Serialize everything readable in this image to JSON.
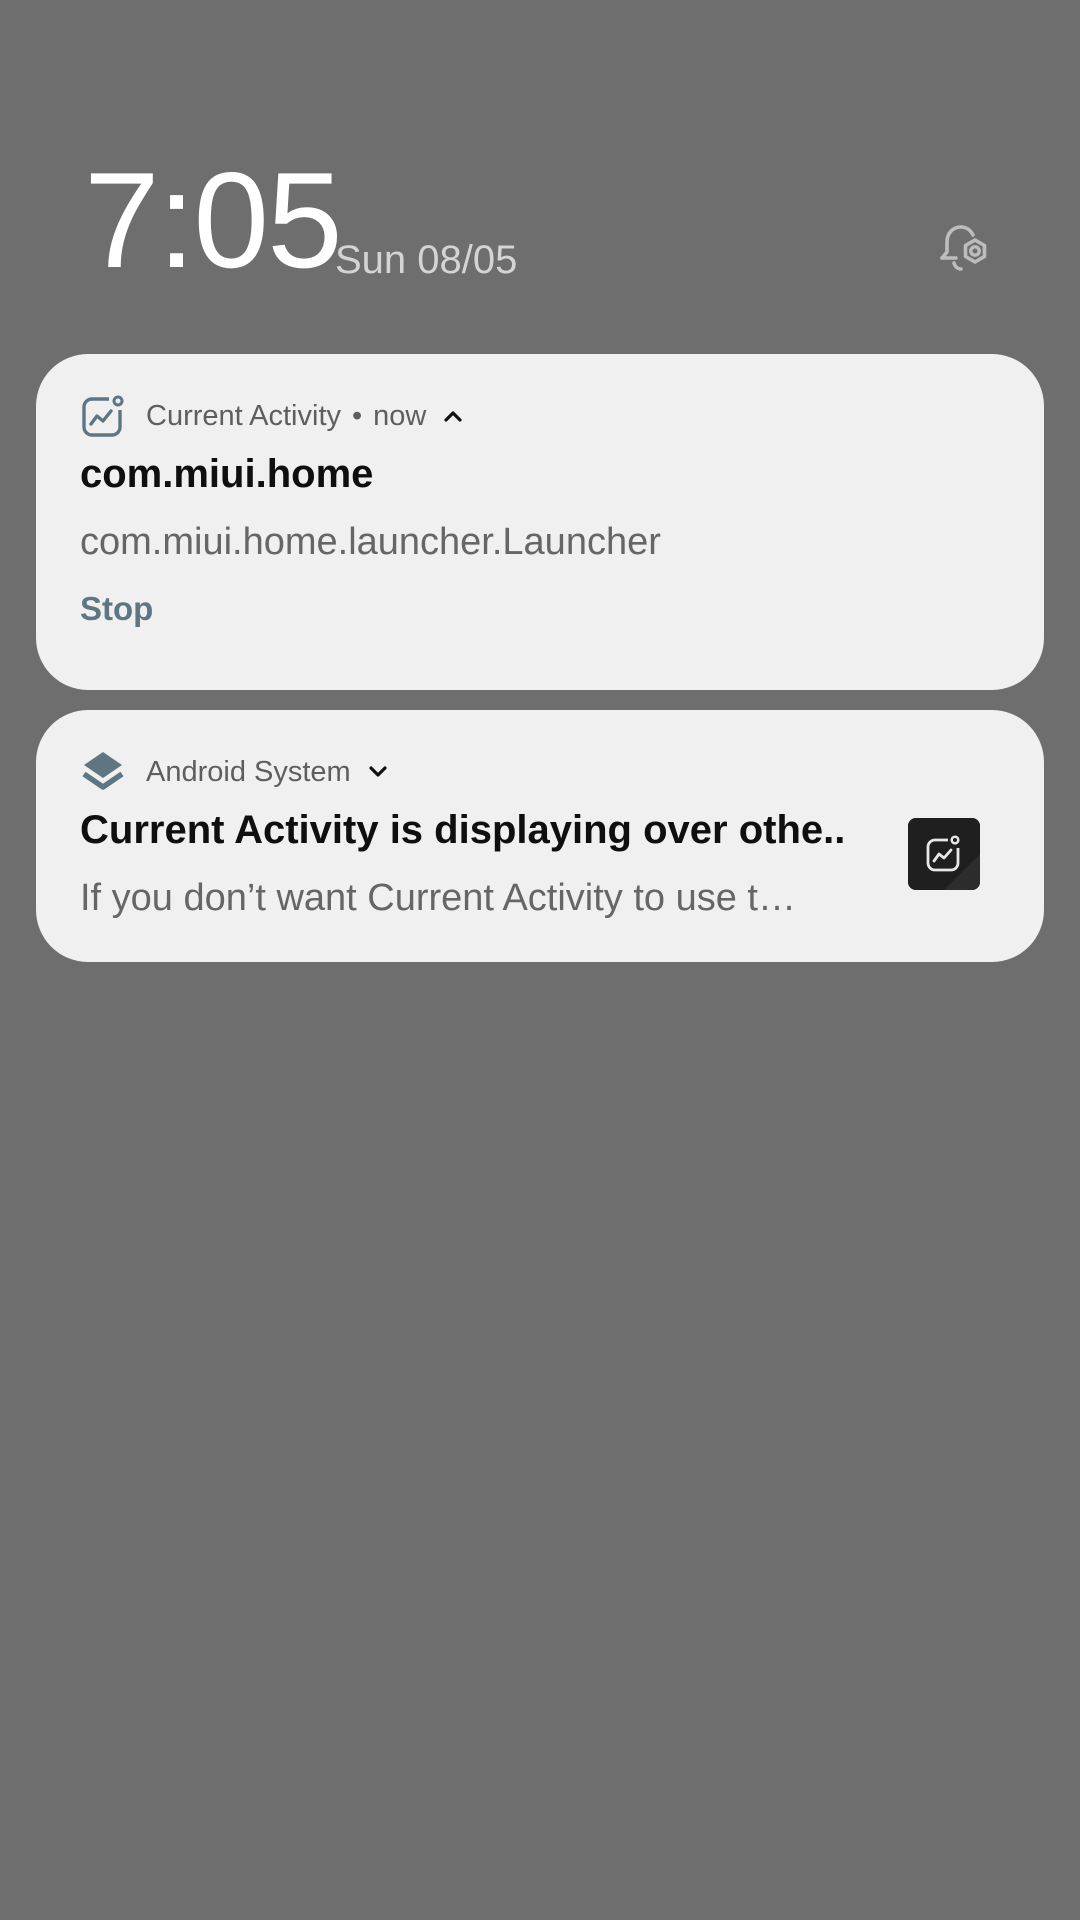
{
  "header": {
    "time": "7:05",
    "date": "Sun 08/05",
    "settings_icon": "notification-settings-icon"
  },
  "notifications": [
    {
      "app_name": "Current Activity",
      "separator": "•",
      "time": "now",
      "icon": "current-activity-chart-icon",
      "expanded": true,
      "title": "com.miui.home",
      "text": "com.miui.home.launcher.Launcher",
      "action_label": "Stop"
    },
    {
      "app_name": "Android System",
      "icon": "android-system-layers-icon",
      "expanded": false,
      "title": "Current Activity is displaying over othe..",
      "text": "If you don’t want Current Activity to use t…"
    }
  ],
  "colors": {
    "background": "#6e6e6e",
    "card": "#f0f0f0",
    "accent": "#5e7682",
    "thumbnail": "#1f1f1f"
  }
}
